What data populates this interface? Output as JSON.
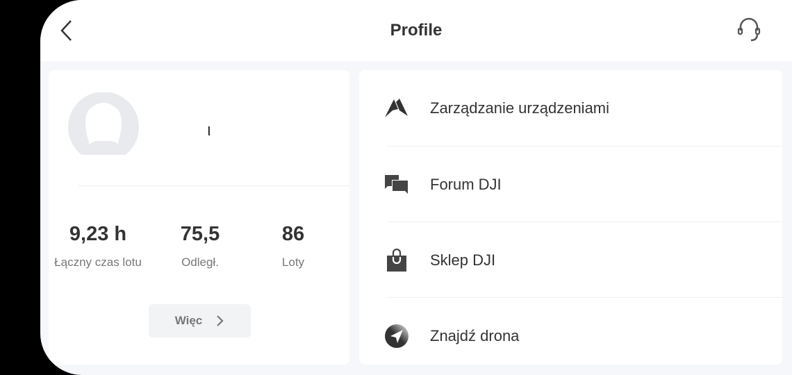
{
  "header": {
    "title": "Profile",
    "back_icon": "chevron-left-icon",
    "support_icon": "headset-icon"
  },
  "profile": {
    "name": "ו",
    "stats": [
      {
        "value": "9,23 h",
        "label": "Łączny czas lotu"
      },
      {
        "value": "75,5",
        "label": "Odległ."
      },
      {
        "value": "86",
        "label": "Loty"
      }
    ],
    "more_label": "Więc"
  },
  "menu": [
    {
      "label": "Zarządzanie urządzeniami",
      "icon": "device-icon"
    },
    {
      "label": "Forum DJI",
      "icon": "forum-icon"
    },
    {
      "label": "Sklep DJI",
      "icon": "shopping-bag-icon"
    },
    {
      "label": "Znajdź drona",
      "icon": "find-drone-icon"
    }
  ]
}
